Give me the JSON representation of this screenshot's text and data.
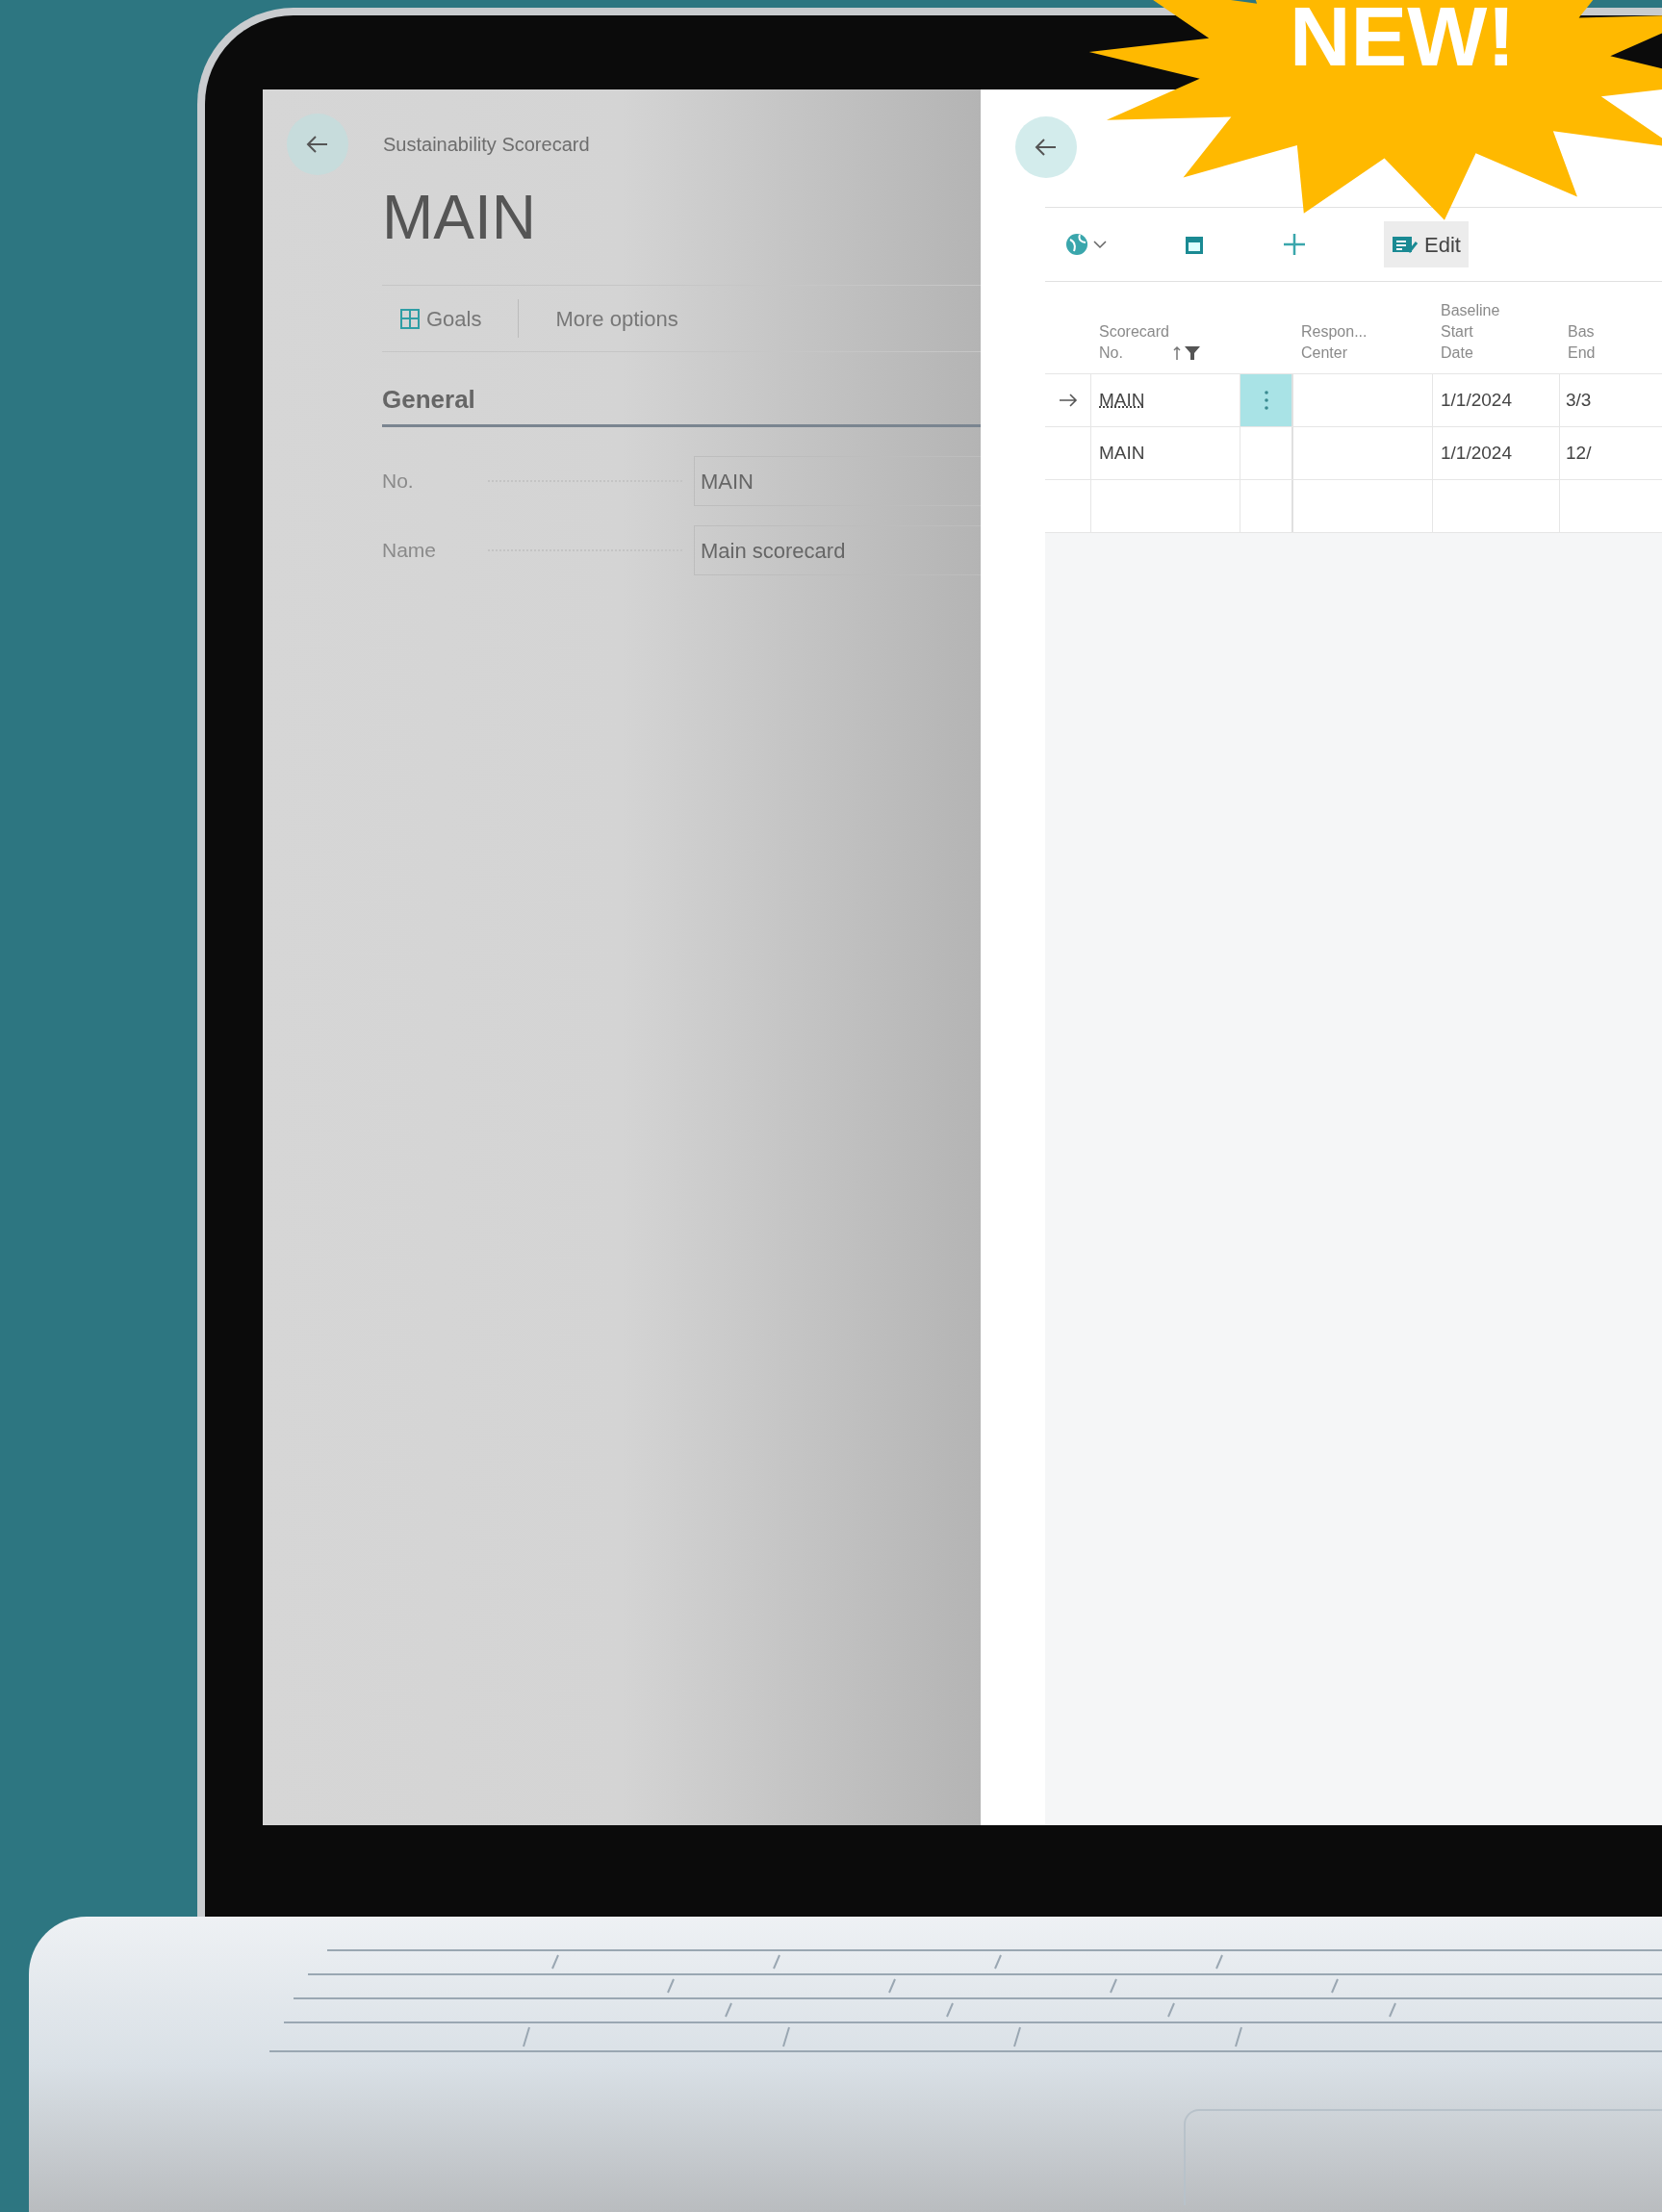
{
  "badge": {
    "text": "NEW!"
  },
  "card_page": {
    "breadcrumb": "Sustainability Scorecard",
    "title": "MAIN",
    "actions": [
      {
        "kind": "icon",
        "label": "Goals"
      },
      {
        "kind": "plain",
        "label": "More options"
      }
    ],
    "section": "General",
    "fields": [
      {
        "label": "No.",
        "value": "MAIN"
      },
      {
        "label": "Name",
        "value": "Main scorecard"
      }
    ]
  },
  "list_page": {
    "toolbar": [
      {
        "kind": "globe"
      },
      {
        "kind": "calendar"
      },
      {
        "kind": "plus"
      },
      {
        "kind": "edit",
        "label": "Edit"
      }
    ],
    "columns": [
      {
        "lines": [
          "Scorecard",
          "No."
        ],
        "sorted": true,
        "filtered": true
      },
      {
        "lines": [
          "Respon...",
          "Center"
        ]
      },
      {
        "lines": [
          "Baseline",
          "Start",
          "Date"
        ]
      },
      {
        "lines": [
          "Bas",
          "End"
        ]
      }
    ],
    "rows": [
      {
        "selected": true,
        "no": "MAIN",
        "start": "1/1/2024",
        "end": "3/3"
      },
      {
        "selected": false,
        "no": "MAIN",
        "start": "1/1/2024",
        "end": "12/"
      }
    ]
  }
}
